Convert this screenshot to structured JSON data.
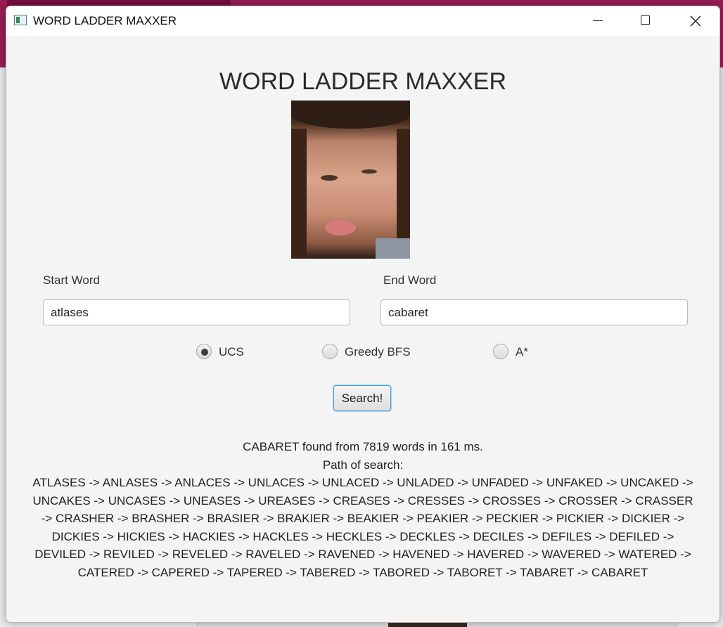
{
  "window": {
    "title": "WORD LADDER MAXXER"
  },
  "heading": "WORD LADDER MAXXER",
  "form": {
    "start_label": "Start Word",
    "start_value": "atlases",
    "end_label": "End Word",
    "end_value": "cabaret"
  },
  "algorithms": [
    {
      "label": "UCS",
      "selected": true
    },
    {
      "label": "Greedy BFS",
      "selected": false
    },
    {
      "label": "A*",
      "selected": false
    }
  ],
  "search_button": "Search!",
  "result": {
    "summary": "CABARET found from 7819 words in 161 ms.",
    "path_label": "Path of search:",
    "path": "ATLASES -> ANLASES -> ANLACES -> UNLACES -> UNLACED -> UNLADED -> UNFADED -> UNFAKED -> UNCAKED -> UNCAKES -> UNCASES -> UNEASES -> UREASES -> CREASES -> CRESSES -> CROSSES -> CROSSER -> CRASSER -> CRASHER -> BRASHER -> BRASIER -> BRAKIER -> BEAKIER -> PEAKIER -> PECKIER -> PICKIER -> DICKIER -> DICKIES -> HICKIES -> HACKIES -> HACKLES -> HECKLES -> DECKLES -> DECILES -> DEFILES -> DEFILED -> DEVILED -> REVILED -> REVELED -> RAVELED -> RAVENED -> HAVENED -> HAVERED -> WAVERED -> WATERED -> CATERED -> CAPERED -> TAPERED -> TABERED -> TABORED -> TABORET -> TABARET -> CABARET"
  }
}
